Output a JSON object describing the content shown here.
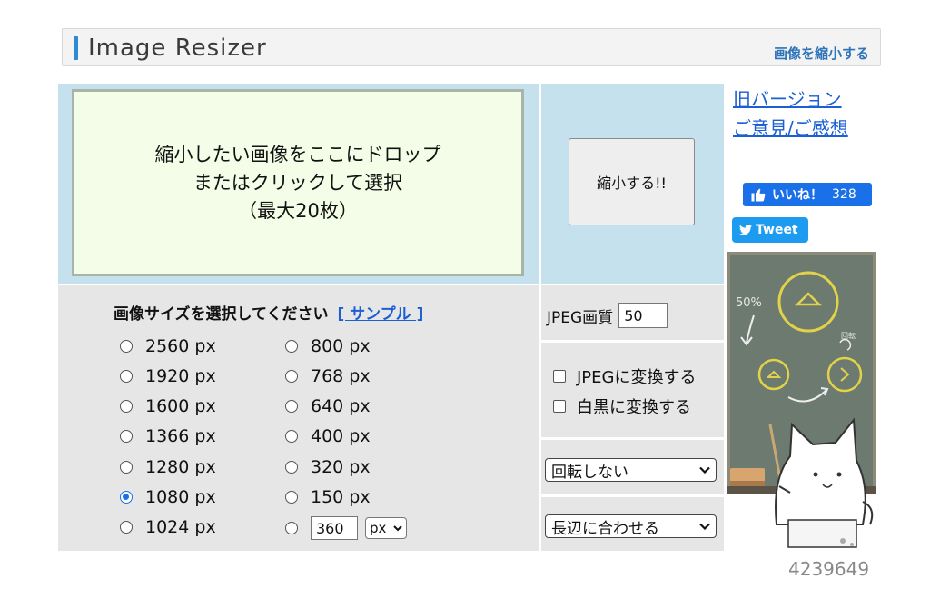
{
  "header": {
    "title": "Image Resizer",
    "subtitle": "画像を縮小する"
  },
  "drop_zone": {
    "lines": [
      "縮小したい画像をここにドロップ",
      "またはクリックして選択",
      "（最大20枚）"
    ]
  },
  "shrink_button": "縮小する!!",
  "links": {
    "old_version": "旧バージョン",
    "feedback": "ご意見/ご感想"
  },
  "like": {
    "label": "いいね！",
    "count": "328"
  },
  "tweet": "Tweet",
  "sizes": {
    "heading": "画像サイズを選択してください",
    "sample_link": "[ サンプル ]",
    "left": [
      "2560 px",
      "1920 px",
      "1600 px",
      "1366 px",
      "1280 px",
      "1080 px",
      "1024 px"
    ],
    "right": [
      "800 px",
      "768 px",
      "640 px",
      "400 px",
      "320 px",
      "150 px"
    ],
    "selected": "1080 px",
    "custom_value": "360",
    "custom_unit": "px"
  },
  "jpeg_quality": {
    "label": "JPEG画質",
    "value": "50"
  },
  "options": {
    "convert_jpeg": "JPEGに変換する",
    "grayscale": "白黒に変換する"
  },
  "rotate_select": "回転しない",
  "fit_select": "長辺に合わせる",
  "illustration": {
    "board_text": "50%",
    "rotate_text": "回転"
  },
  "counter": "4239649",
  "colors": {
    "accent": "#2d8ad3",
    "link": "#1a5fd4",
    "panel_blue": "#c6e1ee",
    "panel_gray": "#e6e6e6",
    "drop_bg": "#f4fde7"
  }
}
